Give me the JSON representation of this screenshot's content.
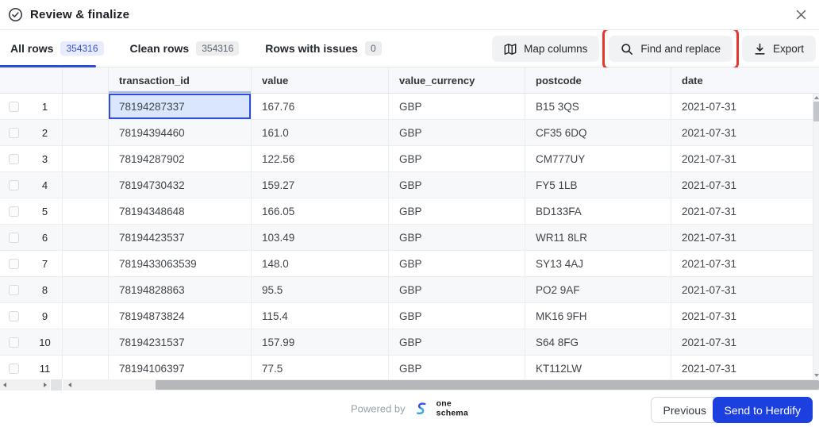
{
  "modal": {
    "title": "Review & finalize"
  },
  "tabs": [
    {
      "label": "All rows",
      "count": "354316",
      "active": true
    },
    {
      "label": "Clean rows",
      "count": "354316",
      "active": false
    },
    {
      "label": "Rows with issues",
      "count": "0",
      "active": false
    }
  ],
  "toolbar": {
    "map_columns_label": "Map columns",
    "find_replace_label": "Find and replace",
    "export_label": "Export"
  },
  "annotation": {
    "highlights": "find-and-replace-button",
    "color": "#e5382c"
  },
  "table": {
    "columns": [
      "transaction_id",
      "value",
      "value_currency",
      "postcode",
      "date"
    ],
    "selected_cell": {
      "row_index": 0,
      "column": "transaction_id"
    },
    "rows": [
      {
        "num": "1",
        "transaction_id": "78194287337",
        "value": "167.76",
        "value_currency": "GBP",
        "postcode": "B15 3QS",
        "date": "2021-07-31"
      },
      {
        "num": "2",
        "transaction_id": "78194394460",
        "value": "161.0",
        "value_currency": "GBP",
        "postcode": "CF35 6DQ",
        "date": "2021-07-31"
      },
      {
        "num": "3",
        "transaction_id": "78194287902",
        "value": "122.56",
        "value_currency": "GBP",
        "postcode": "CM777UY",
        "date": "2021-07-31"
      },
      {
        "num": "4",
        "transaction_id": "78194730432",
        "value": "159.27",
        "value_currency": "GBP",
        "postcode": "FY5 1LB",
        "date": "2021-07-31"
      },
      {
        "num": "5",
        "transaction_id": "78194348648",
        "value": "166.05",
        "value_currency": "GBP",
        "postcode": "BD133FA",
        "date": "2021-07-31"
      },
      {
        "num": "6",
        "transaction_id": "78194423537",
        "value": "103.49",
        "value_currency": "GBP",
        "postcode": "WR11 8LR",
        "date": "2021-07-31"
      },
      {
        "num": "7",
        "transaction_id": "7819433063539",
        "value": "148.0",
        "value_currency": "GBP",
        "postcode": "SY13 4AJ",
        "date": "2021-07-31"
      },
      {
        "num": "8",
        "transaction_id": "78194828863",
        "value": "95.5",
        "value_currency": "GBP",
        "postcode": "PO2 9AF",
        "date": "2021-07-31"
      },
      {
        "num": "9",
        "transaction_id": "78194873824",
        "value": "115.4",
        "value_currency": "GBP",
        "postcode": "MK16 9FH",
        "date": "2021-07-31"
      },
      {
        "num": "10",
        "transaction_id": "78194231537",
        "value": "157.99",
        "value_currency": "GBP",
        "postcode": "S64 8FG",
        "date": "2021-07-31"
      },
      {
        "num": "11",
        "transaction_id": "78194106397",
        "value": "77.5",
        "value_currency": "GBP",
        "postcode": "KT112LW",
        "date": "2021-07-31"
      }
    ]
  },
  "footer": {
    "powered_by": "Powered by",
    "brand_line1": "one",
    "brand_line2": "schema",
    "previous_label": "Previous",
    "send_label": "Send to Herdify"
  },
  "colors": {
    "accent_blue": "#2b4ed6",
    "annotation_red": "#e5382c",
    "cta_blue": "#1c40e0",
    "selected_cell_bg": "#d9e6fb",
    "selected_cell_border": "#2b4fd7",
    "row_alt_bg": "#f7f8f9",
    "header_bg": "#f7f8fb"
  }
}
